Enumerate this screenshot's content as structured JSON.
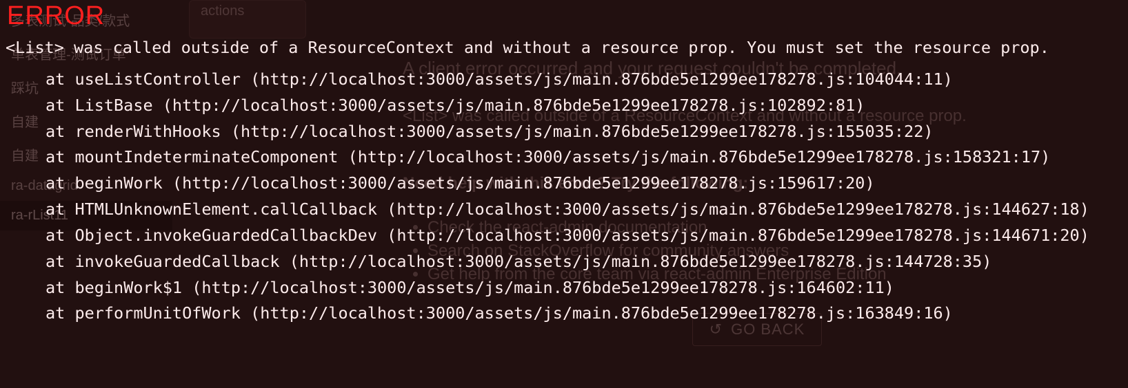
{
  "bg": {
    "sidebar": {
      "items": [
        {
          "label": "多表测试-品类/款式"
        },
        {
          "label": "单表管理-测试订单"
        },
        {
          "label": "踩坑"
        },
        {
          "label": "自建"
        },
        {
          "label": "自建"
        },
        {
          "label": "ra-datagrid"
        },
        {
          "label": "ra-rList11"
        }
      ],
      "active_index": 6
    },
    "card": {
      "label": "actions"
    },
    "errpane": {
      "title": "A client error occurred and your request couldn't be completed.",
      "main_msg": "<List> was called outside of a ResourceContext and without a resource prop.",
      "hint_heading": "Need help with this error? Try the following:",
      "hints": [
        "Check the react-admin documentation",
        "Search on StackOverflow for community answers",
        "Get help from the core team via react-admin Enterprise Edition"
      ],
      "goback_label": "GO BACK"
    }
  },
  "overlay": {
    "error_label": "ERROR",
    "message": "<List> was called outside of a ResourceContext and without a resource prop. You must set the resource prop.",
    "stack": [
      "at useListController (http://localhost:3000/assets/js/main.876bde5e1299ee178278.js:104044:11)",
      "at ListBase (http://localhost:3000/assets/js/main.876bde5e1299ee178278.js:102892:81)",
      "at renderWithHooks (http://localhost:3000/assets/js/main.876bde5e1299ee178278.js:155035:22)",
      "at mountIndeterminateComponent (http://localhost:3000/assets/js/main.876bde5e1299ee178278.js:158321:17)",
      "at beginWork (http://localhost:3000/assets/js/main.876bde5e1299ee178278.js:159617:20)",
      "at HTMLUnknownElement.callCallback (http://localhost:3000/assets/js/main.876bde5e1299ee178278.js:144627:18)",
      "at Object.invokeGuardedCallbackDev (http://localhost:3000/assets/js/main.876bde5e1299ee178278.js:144671:20)",
      "at invokeGuardedCallback (http://localhost:3000/assets/js/main.876bde5e1299ee178278.js:144728:35)",
      "at beginWork$1 (http://localhost:3000/assets/js/main.876bde5e1299ee178278.js:164602:11)",
      "at performUnitOfWork (http://localhost:3000/assets/js/main.876bde5e1299ee178278.js:163849:16)"
    ]
  }
}
